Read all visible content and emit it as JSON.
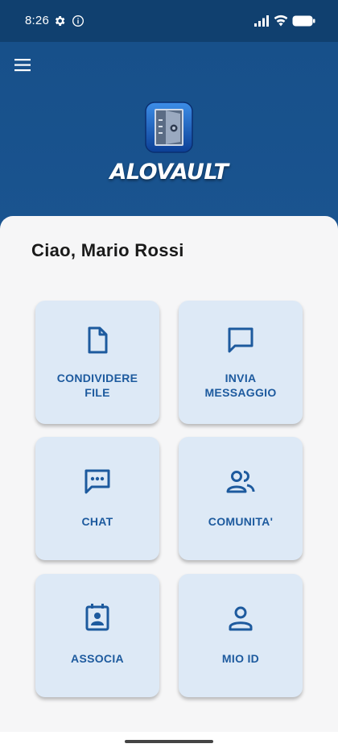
{
  "status": {
    "time": "8:26",
    "icons": [
      "gear-icon",
      "info-icon",
      "signal-icon",
      "wifi-icon",
      "battery-icon"
    ]
  },
  "header": {
    "brand": "ALOVAULT",
    "icons": [
      "menu-icon",
      "vault-logo-icon"
    ]
  },
  "main": {
    "greeting": "Ciao, Mario Rossi",
    "tiles": [
      {
        "line1": "CONDIVIDERE",
        "line2": "FILE",
        "icon": "file-icon"
      },
      {
        "line1": "INVIA",
        "line2": "MESSAGGIO",
        "icon": "message-icon"
      },
      {
        "line1": "CHAT",
        "line2": "",
        "icon": "chat-icon"
      },
      {
        "line1": "COMUNITA'",
        "line2": "",
        "icon": "community-icon"
      },
      {
        "line1": "ASSOCIA",
        "line2": "",
        "icon": "badge-icon"
      },
      {
        "line1": "MIO ID",
        "line2": "",
        "icon": "person-icon"
      }
    ]
  },
  "colors": {
    "header": "#17508a",
    "status_bar": "#10406f",
    "tile_bg": "#dde9f6",
    "tile_text": "#1d5a9e",
    "sheet_bg": "#f6f6f7"
  }
}
